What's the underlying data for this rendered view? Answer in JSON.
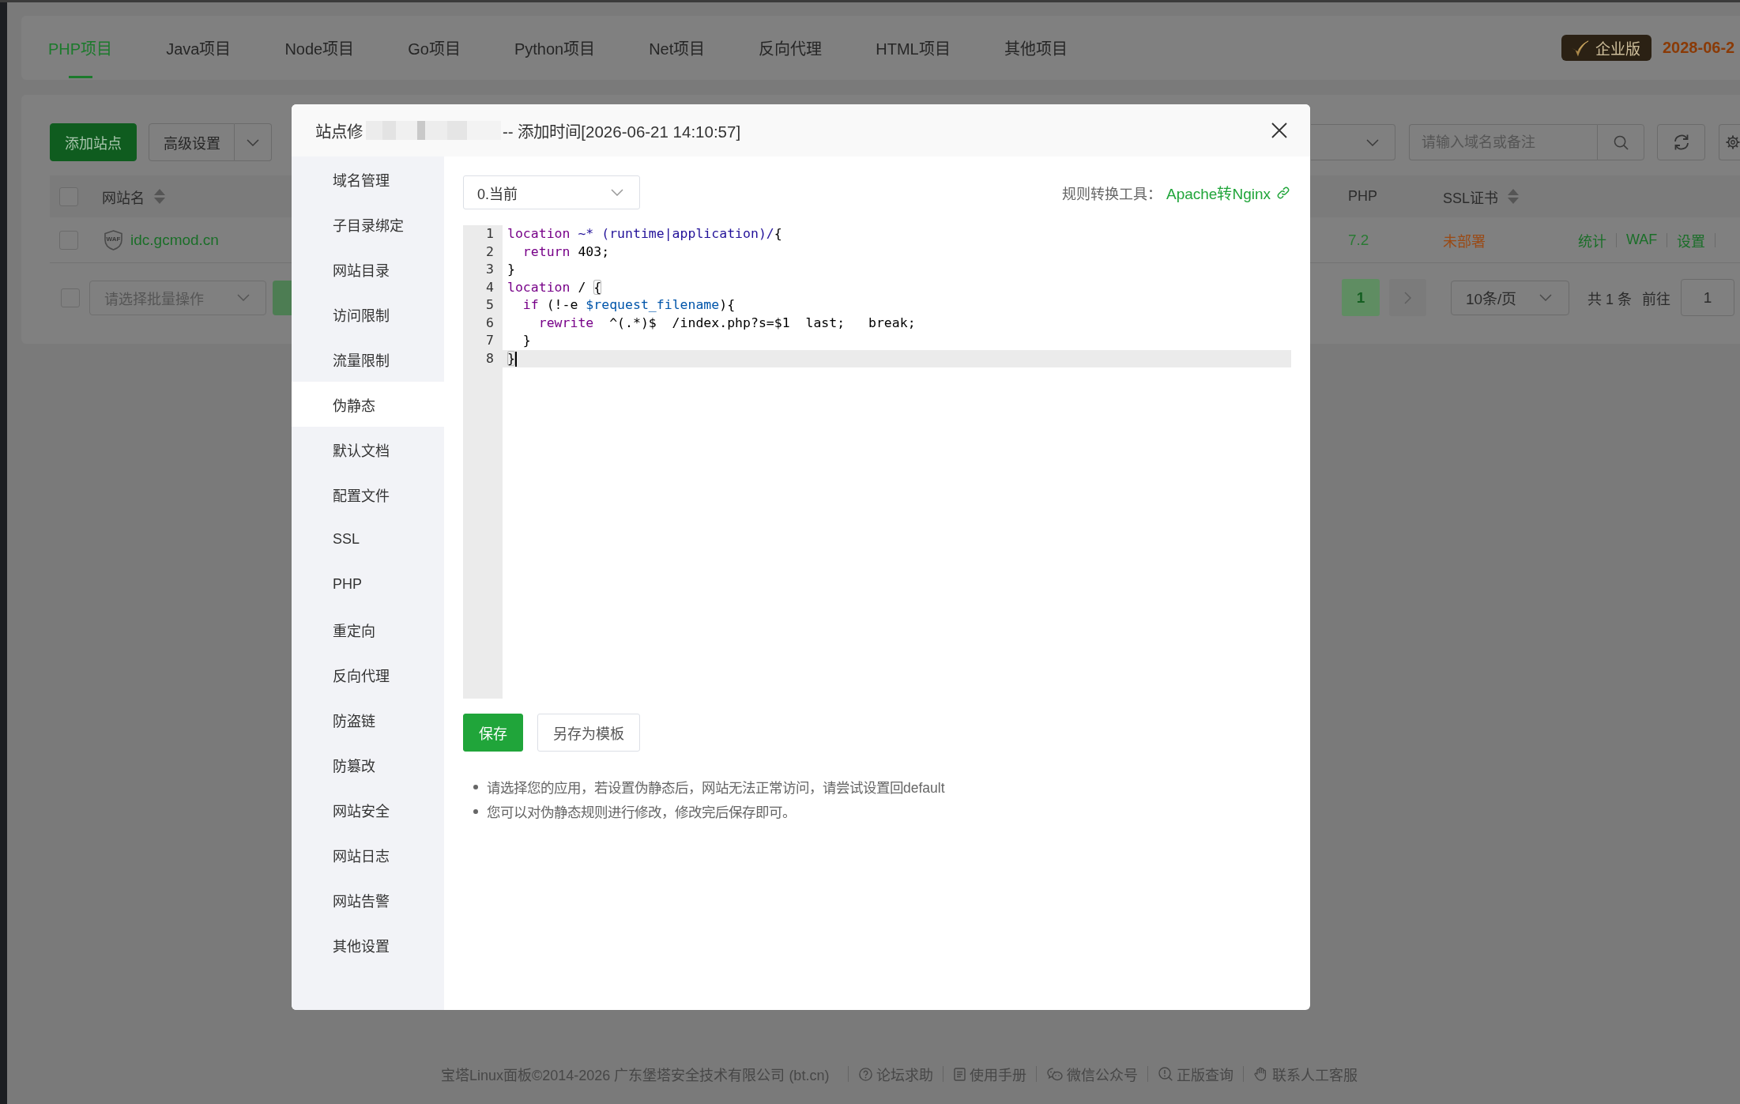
{
  "app_tabs": [
    {
      "label": "PHP项目",
      "selected": true
    },
    {
      "label": "Java项目",
      "selected": false
    },
    {
      "label": "Node项目",
      "selected": false
    },
    {
      "label": "Go项目",
      "selected": false
    },
    {
      "label": "Python项目",
      "selected": false
    },
    {
      "label": "Net项目",
      "selected": false
    },
    {
      "label": "反向代理",
      "selected": false
    },
    {
      "label": "HTML项目",
      "selected": false
    },
    {
      "label": "其他项目",
      "selected": false
    }
  ],
  "edition_badge": "企业版",
  "expiry_date": "2028-06-2",
  "toolbar": {
    "add_site_button": "添加站点",
    "advanced_settings_button": "高级设置",
    "search": {
      "placeholder": "请输入域名或备注"
    }
  },
  "site_table": {
    "select_all": {
      "checked": false
    },
    "columns": [
      {
        "label": "网站名",
        "kind": "sortable"
      },
      {
        "label": "PHP",
        "kind": "plain"
      },
      {
        "label": "SSL证书",
        "kind": "sortable"
      }
    ],
    "rows": [
      {
        "checked": false,
        "waf_badge": "WAF",
        "name": "idc.gcmod.cn",
        "php": "7.2",
        "ssl": "未部署",
        "actions": [
          "统计",
          "WAF",
          "设置"
        ]
      }
    ]
  },
  "batch_bar": {
    "checked": false,
    "action_select": {
      "placeholder": "请选择批量操作"
    }
  },
  "pagination": {
    "pages": [
      {
        "label": "1",
        "selected": true
      }
    ],
    "page_size": "10条/页",
    "total": "共 1 条",
    "goto_label": "前往",
    "goto_value": "1"
  },
  "dialog": {
    "title_start": "站点修",
    "title_end": "-- 添加时间[2026-06-21 14:10:57]",
    "menu": [
      {
        "label": "域名管理",
        "selected": false
      },
      {
        "label": "子目录绑定",
        "selected": false
      },
      {
        "label": "网站目录",
        "selected": false
      },
      {
        "label": "访问限制",
        "selected": false
      },
      {
        "label": "流量限制",
        "selected": false
      },
      {
        "label": "伪静态",
        "selected": true
      },
      {
        "label": "默认文档",
        "selected": false
      },
      {
        "label": "配置文件",
        "selected": false
      },
      {
        "label": "SSL",
        "selected": false
      },
      {
        "label": "PHP",
        "selected": false
      },
      {
        "label": "重定向",
        "selected": false
      },
      {
        "label": "反向代理",
        "selected": false
      },
      {
        "label": "防盗链",
        "selected": false
      },
      {
        "label": "防篡改",
        "selected": false
      },
      {
        "label": "网站安全",
        "selected": false
      },
      {
        "label": "网站日志",
        "selected": false
      },
      {
        "label": "网站告警",
        "selected": false
      },
      {
        "label": "其他设置",
        "selected": false
      }
    ],
    "version_select": "0.当前",
    "converter_label": "规则转换工具：",
    "converter_link": "Apache转Nginx",
    "editor": {
      "lines": [
        {
          "number": "1",
          "active": false,
          "tokens": [
            {
              "kind": "keyword",
              "text": "location"
            },
            {
              "kind": "atom",
              "text": " ~* (runtime|application)/"
            },
            {
              "kind": "plain",
              "text": "{"
            }
          ]
        },
        {
          "number": "2",
          "active": false,
          "tokens": [
            {
              "kind": "keyword",
              "text": "  return"
            },
            {
              "kind": "plain",
              "text": " 403;"
            }
          ]
        },
        {
          "number": "3",
          "active": false,
          "tokens": [
            {
              "kind": "plain",
              "text": "}"
            }
          ]
        },
        {
          "number": "4",
          "active": false,
          "tokens": [
            {
              "kind": "keyword",
              "text": "location"
            },
            {
              "kind": "plain",
              "text": " / "
            },
            {
              "kind": "matched_bracket",
              "text": "{"
            }
          ]
        },
        {
          "number": "5",
          "active": false,
          "tokens": [
            {
              "kind": "keyword",
              "text": "  if"
            },
            {
              "kind": "plain",
              "text": " (!-e "
            },
            {
              "kind": "variable",
              "text": "$request_filename"
            },
            {
              "kind": "plain",
              "text": "){"
            }
          ]
        },
        {
          "number": "6",
          "active": false,
          "tokens": [
            {
              "kind": "keyword",
              "text": "    rewrite"
            },
            {
              "kind": "plain",
              "text": "  ^(.*)$  /index.php?s=$1  last;   break;"
            }
          ]
        },
        {
          "number": "7",
          "active": false,
          "tokens": [
            {
              "kind": "plain",
              "text": "  }"
            }
          ]
        },
        {
          "number": "8",
          "active": true,
          "tokens": [
            {
              "kind": "matched_bracket",
              "text": "}"
            }
          ]
        }
      ]
    },
    "buttons": [
      {
        "kind": "primary",
        "label": "保存"
      },
      {
        "kind": "default",
        "label": "另存为模板"
      }
    ],
    "notes": [
      "请选择您的应用，若设置伪静态后，网站无法正常访问，请尝试设置回default",
      "您可以对伪静态规则进行修改，修改完后保存即可。"
    ]
  },
  "footer": {
    "copyright": "宝塔Linux面板©2014-2026 广东堡塔安全技术有限公司 (bt.cn)",
    "links": [
      {
        "kind": "forum",
        "label": "论坛求助"
      },
      {
        "kind": "manual",
        "label": "使用手册"
      },
      {
        "kind": "wechat",
        "label": "微信公众号"
      },
      {
        "kind": "verify",
        "label": "正版查询"
      },
      {
        "kind": "support",
        "label": "联系人工客服"
      }
    ]
  }
}
